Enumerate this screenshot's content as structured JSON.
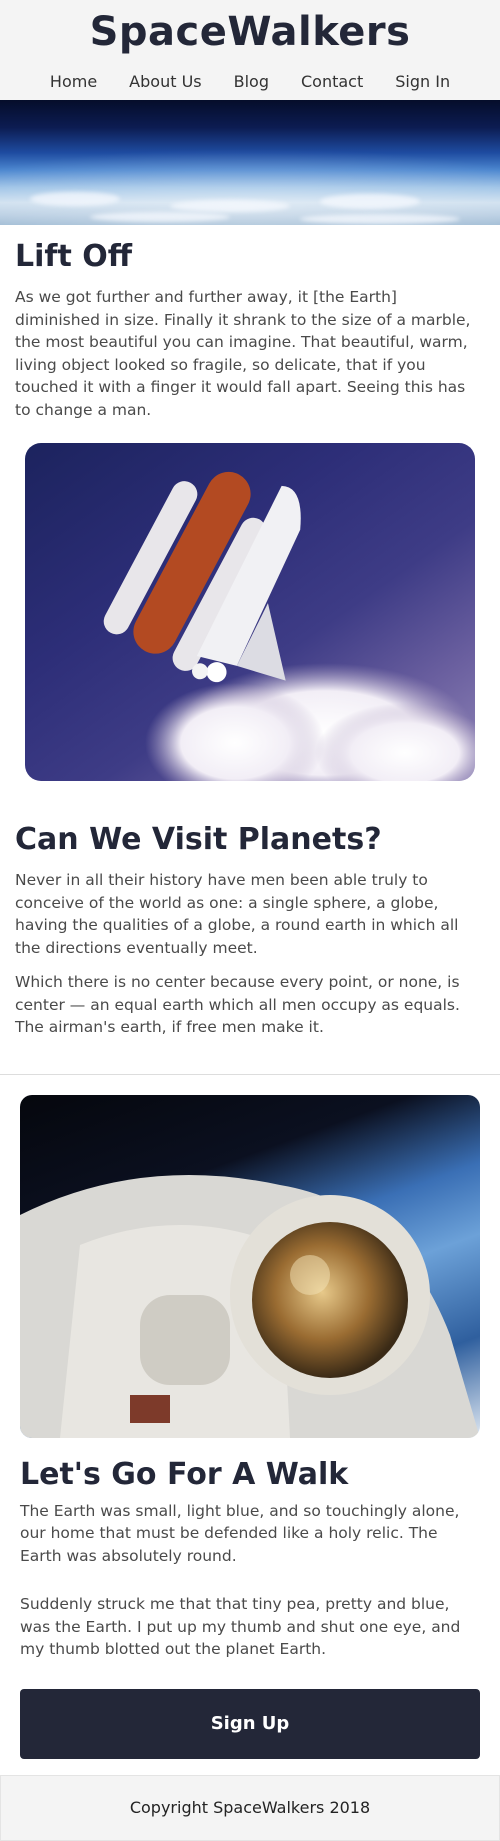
{
  "header": {
    "site_title": "SpaceWalkers",
    "nav": [
      {
        "label": "Home"
      },
      {
        "label": "About Us"
      },
      {
        "label": "Blog"
      },
      {
        "label": "Contact"
      },
      {
        "label": "Sign In"
      }
    ]
  },
  "sections": {
    "lift_off": {
      "heading": "Lift Off",
      "paragraph": "As we got further and further away, it [the Earth] diminished in size. Finally it shrank to the size of a marble, the most beautiful you can imagine. That beautiful, warm, living object looked so fragile, so delicate, that if you touched it with a finger it would fall apart. Seeing this has to change a man."
    },
    "visit_planets": {
      "heading": "Can We Visit Planets?",
      "paragraph_1": "Never in all their history have men been able truly to conceive of the world as one: a single sphere, a globe, having the qualities of a globe, a round earth in which all the directions eventually meet.",
      "paragraph_2": "Which there is no center because every point, or none, is center — an equal earth which all men occupy as equals. The airman's earth, if free men make it."
    },
    "walk": {
      "heading": "Let's Go For A Walk",
      "paragraph_1": "The Earth was small, light blue, and so touchingly alone, our home that must be defended like a holy relic. The Earth was absolutely round.",
      "paragraph_2": "Suddenly struck me that that tiny pea, pretty and blue, was the Earth. I put up my thumb and shut one eye, and my thumb blotted out the planet Earth."
    }
  },
  "cta": {
    "signup_label": "Sign Up"
  },
  "footer": {
    "copyright": "Copyright SpaceWalkers 2018"
  },
  "colors": {
    "header_bg": "#f4f4f4",
    "heading_text": "#232738",
    "body_text": "#4a4a4a",
    "button_bg": "#232738",
    "button_text": "#ffffff"
  }
}
